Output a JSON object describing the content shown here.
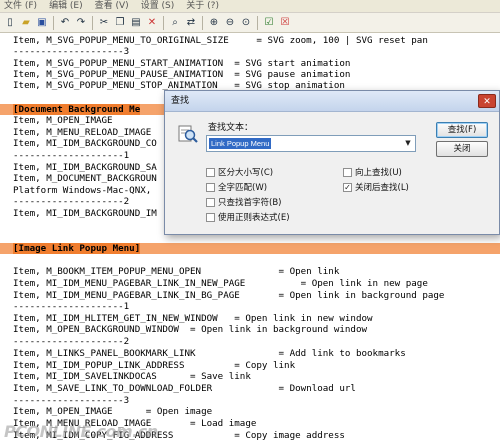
{
  "menubar": {
    "items": [
      "文件 (F)",
      "编辑 (E)",
      "查看 (V)",
      "设置 (S)",
      "关于 (?)"
    ]
  },
  "toolbar": {
    "buttons": [
      "new-file-icon",
      "open-folder-icon",
      "save-icon",
      "undo-icon",
      "redo-icon",
      "cut-icon",
      "copy-icon",
      "paste-icon",
      "delete-icon",
      "find-icon",
      "replace-icon",
      "zoom-in-icon",
      "zoom-out-icon",
      "zoom-reset-icon",
      "checkmark-icon",
      "close-icon"
    ]
  },
  "editor": {
    "lines": [
      "Item, M_SVG_POPUP_MENU_TO_ORIGINAL_SIZE     = SVG zoom, 100 | SVG reset pan",
      "--------------------3",
      "Item, M_SVG_POPUP_MENU_START_ANIMATION  = SVG start animation",
      "Item, M_SVG_POPUP_MENU_PAUSE_ANIMATION  = SVG pause animation",
      "Item, M_SVG_POPUP_MENU_STOP_ANIMATION   = SVG stop animation",
      "",
      "[Document Background Me",
      "Item, M_OPEN_IMAGE",
      "Item, M_MENU_RELOAD_IMAGE",
      "Item, MI_IDM_BACKGROUND_CO",
      "--------------------1",
      "Item, MI_IDM_BACKGROUND_SA",
      "Item, M_DOCUMENT_BACKGROUN",
      "Platform Windows-Mac-QNX,",
      "--------------------2",
      "Item, MI_IDM_BACKGROUND_IM",
      "",
      "",
      "[Image Link Popup Menu]",
      "",
      "Item, M_BOOKM_ITEM_POPUP_MENU_OPEN              = Open link",
      "Item, MI_IDM_MENU_PAGEBAR_LINK_IN_NEW_PAGE          = Open link in new page",
      "Item, MI_IDM_MENU_PAGEBAR_LINK_IN_BG_PAGE       = Open link in background page",
      "--------------------1",
      "Item, MI_IDM_HLITEM_GET_IN_NEW_WINDOW   = Open link in new window",
      "Item, M_OPEN_BACKGROUND_WINDOW  = Open link in background window",
      "--------------------2",
      "Item, M_LINKS_PANEL_BOOKMARK_LINK               = Add link to bookmarks",
      "Item, MI_IDM_POPUP_LINK_ADDRESS         = Copy link",
      "Item, MI_IDM_SAVELINKDOCAS      = Save link",
      "Item, M_SAVE_LINK_TO_DOWNLOAD_FOLDER            = Download url",
      "--------------------3",
      "Item, M_OPEN_IMAGE      = Open image",
      "Item, M_MENU_RELOAD_IMAGE       = Load image",
      "Item, MI_IDM_COPY_FIG_ADDRESS           = Copy image address"
    ]
  },
  "dialog": {
    "title": "查找",
    "close": "✕",
    "find_label": "查找文本：",
    "find_value": "Link Popup Menu",
    "find_button": "查找(F)",
    "close_button": "关闭",
    "options": {
      "match_case": "区分大小写(C)",
      "whole_word": "全字匹配(W)",
      "word_start": "只查找首字符(B)",
      "regex": "使用正则表达式(E)",
      "search_up": "向上查找(U)",
      "close_after": "关闭后查找(L)"
    },
    "checked": {
      "close_after": true
    }
  },
  "watermark": {
    "text": "PCONLINE.com.cn"
  }
}
